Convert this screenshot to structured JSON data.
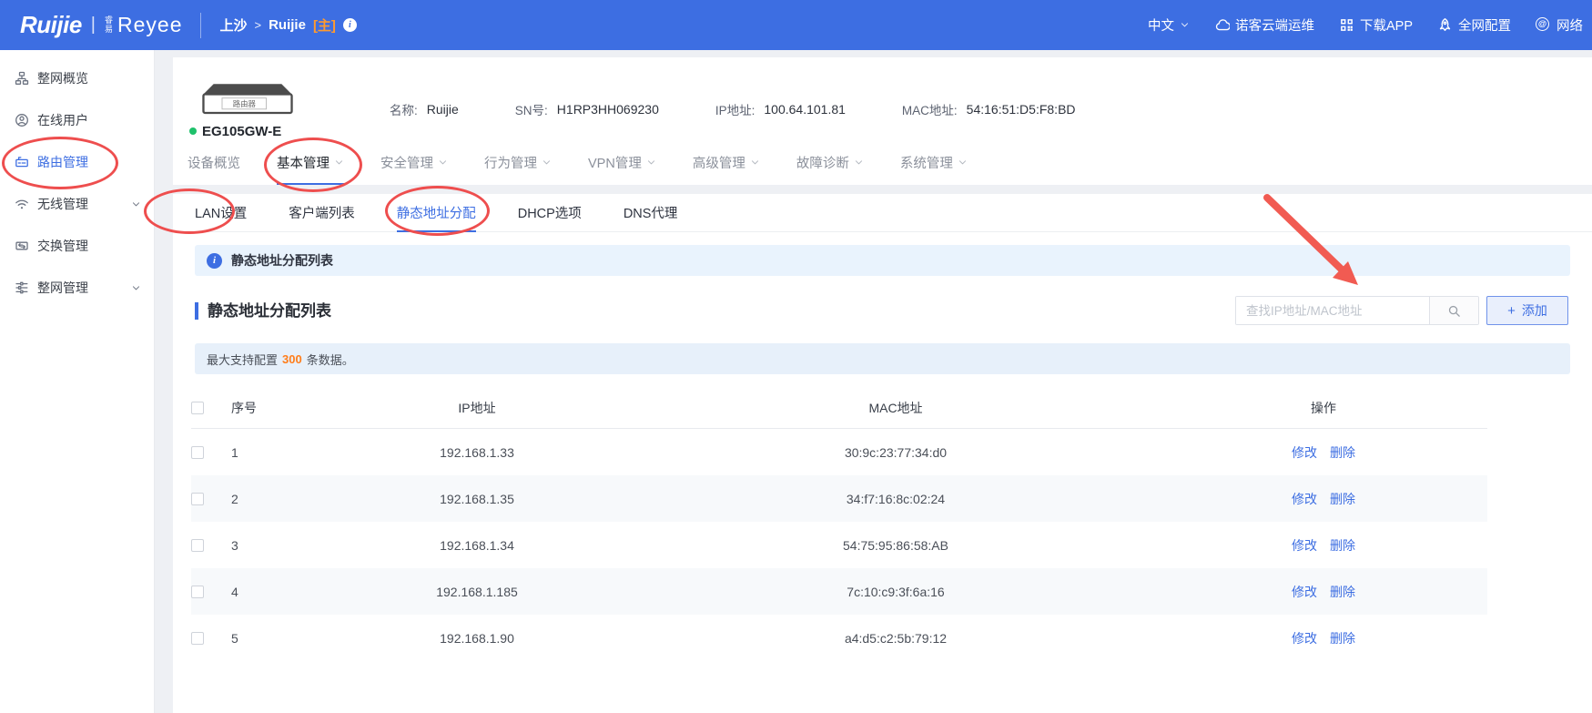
{
  "header": {
    "logo": {
      "brand": "Ruijie",
      "divider": "|",
      "sub_cn": "睿易",
      "sub": "Reyee"
    },
    "breadcrumb": {
      "site": "上沙",
      "separator": ">",
      "device": "Ruijie",
      "badge": "[主]"
    },
    "actions": [
      {
        "id": "language",
        "label": "中文",
        "icon": "chevron-down-icon"
      },
      {
        "id": "cloud-ops",
        "label": "诺客云端运维",
        "icon": "cloud-icon"
      },
      {
        "id": "download-app",
        "label": "下载APP",
        "icon": "qr-code-icon"
      },
      {
        "id": "whole-network-config",
        "label": "全网配置",
        "icon": "rocket-icon"
      },
      {
        "id": "network",
        "label": "网络",
        "icon": "at-circle-icon"
      }
    ]
  },
  "sidebar": {
    "items": [
      {
        "id": "overview",
        "label": "整网概览",
        "icon": "topology-icon",
        "active": false,
        "expandable": false
      },
      {
        "id": "online-users",
        "label": "在线用户",
        "icon": "online-user-icon",
        "active": false,
        "expandable": false
      },
      {
        "id": "router-mgmt",
        "label": "路由管理",
        "icon": "router-icon",
        "active": true,
        "expandable": false
      },
      {
        "id": "wireless-mgmt",
        "label": "无线管理",
        "icon": "wifi-icon",
        "active": false,
        "expandable": true
      },
      {
        "id": "switch-mgmt",
        "label": "交换管理",
        "icon": "switch-icon",
        "active": false,
        "expandable": false
      },
      {
        "id": "network-mgmt",
        "label": "整网管理",
        "icon": "network-mgmt-icon",
        "active": false,
        "expandable": true
      }
    ]
  },
  "device": {
    "type_label": "路由器",
    "model": "EG105GW-E",
    "status": "online",
    "fields": [
      {
        "id": "name",
        "label": "名称:",
        "value": "Ruijie"
      },
      {
        "id": "sn",
        "label": "SN号:",
        "value": "H1RP3HH069230"
      },
      {
        "id": "ip",
        "label": "IP地址:",
        "value": "100.64.101.81"
      },
      {
        "id": "mac",
        "label": "MAC地址:",
        "value": "54:16:51:D5:F8:BD"
      }
    ]
  },
  "main_tabs": [
    {
      "id": "device-overview",
      "label": "设备概览",
      "active": false,
      "dropdown": false
    },
    {
      "id": "basic-mgmt",
      "label": "基本管理",
      "active": true,
      "dropdown": true
    },
    {
      "id": "security-mgmt",
      "label": "安全管理",
      "active": false,
      "dropdown": true
    },
    {
      "id": "behavior-mgmt",
      "label": "行为管理",
      "active": false,
      "dropdown": true
    },
    {
      "id": "vpn-mgmt",
      "label": "VPN管理",
      "active": false,
      "dropdown": true
    },
    {
      "id": "advanced-mgmt",
      "label": "高级管理",
      "active": false,
      "dropdown": true
    },
    {
      "id": "diagnostics",
      "label": "故障诊断",
      "active": false,
      "dropdown": true
    },
    {
      "id": "system-mgmt",
      "label": "系统管理",
      "active": false,
      "dropdown": true
    }
  ],
  "sub_tabs": [
    {
      "id": "lan-settings",
      "label": "LAN设置",
      "active": false
    },
    {
      "id": "client-list",
      "label": "客户端列表",
      "active": false
    },
    {
      "id": "static-ip",
      "label": "静态地址分配",
      "active": true
    },
    {
      "id": "dhcp-options",
      "label": "DHCP选项",
      "active": false
    },
    {
      "id": "dns-proxy",
      "label": "DNS代理",
      "active": false
    }
  ],
  "info_banner": {
    "text": "静态地址分配列表"
  },
  "list_section": {
    "title": "静态地址分配列表",
    "search_placeholder": "查找IP地址/MAC地址",
    "add_button": "添加",
    "notice": {
      "prefix": "最大支持配置",
      "highlight": "300",
      "suffix": "条数据。"
    }
  },
  "table": {
    "columns": [
      "序号",
      "IP地址",
      "MAC地址",
      "操作"
    ],
    "row_actions": [
      "修改",
      "删除"
    ],
    "rows": [
      {
        "no": "1",
        "ip": "192.168.1.33",
        "mac": "30:9c:23:77:34:d0"
      },
      {
        "no": "2",
        "ip": "192.168.1.35",
        "mac": "34:f7:16:8c:02:24"
      },
      {
        "no": "3",
        "ip": "192.168.1.34",
        "mac": "54:75:95:86:58:AB"
      },
      {
        "no": "4",
        "ip": "192.168.1.185",
        "mac": "7c:10:c9:3f:6a:16"
      },
      {
        "no": "5",
        "ip": "192.168.1.90",
        "mac": "a4:d5:c2:5b:79:12"
      }
    ]
  },
  "colors": {
    "accent_blue": "#3d6ee2",
    "highlight_orange": "#ff7d1a",
    "annotation_red": "#ee4e4e",
    "online_green": "#1ec16b"
  }
}
